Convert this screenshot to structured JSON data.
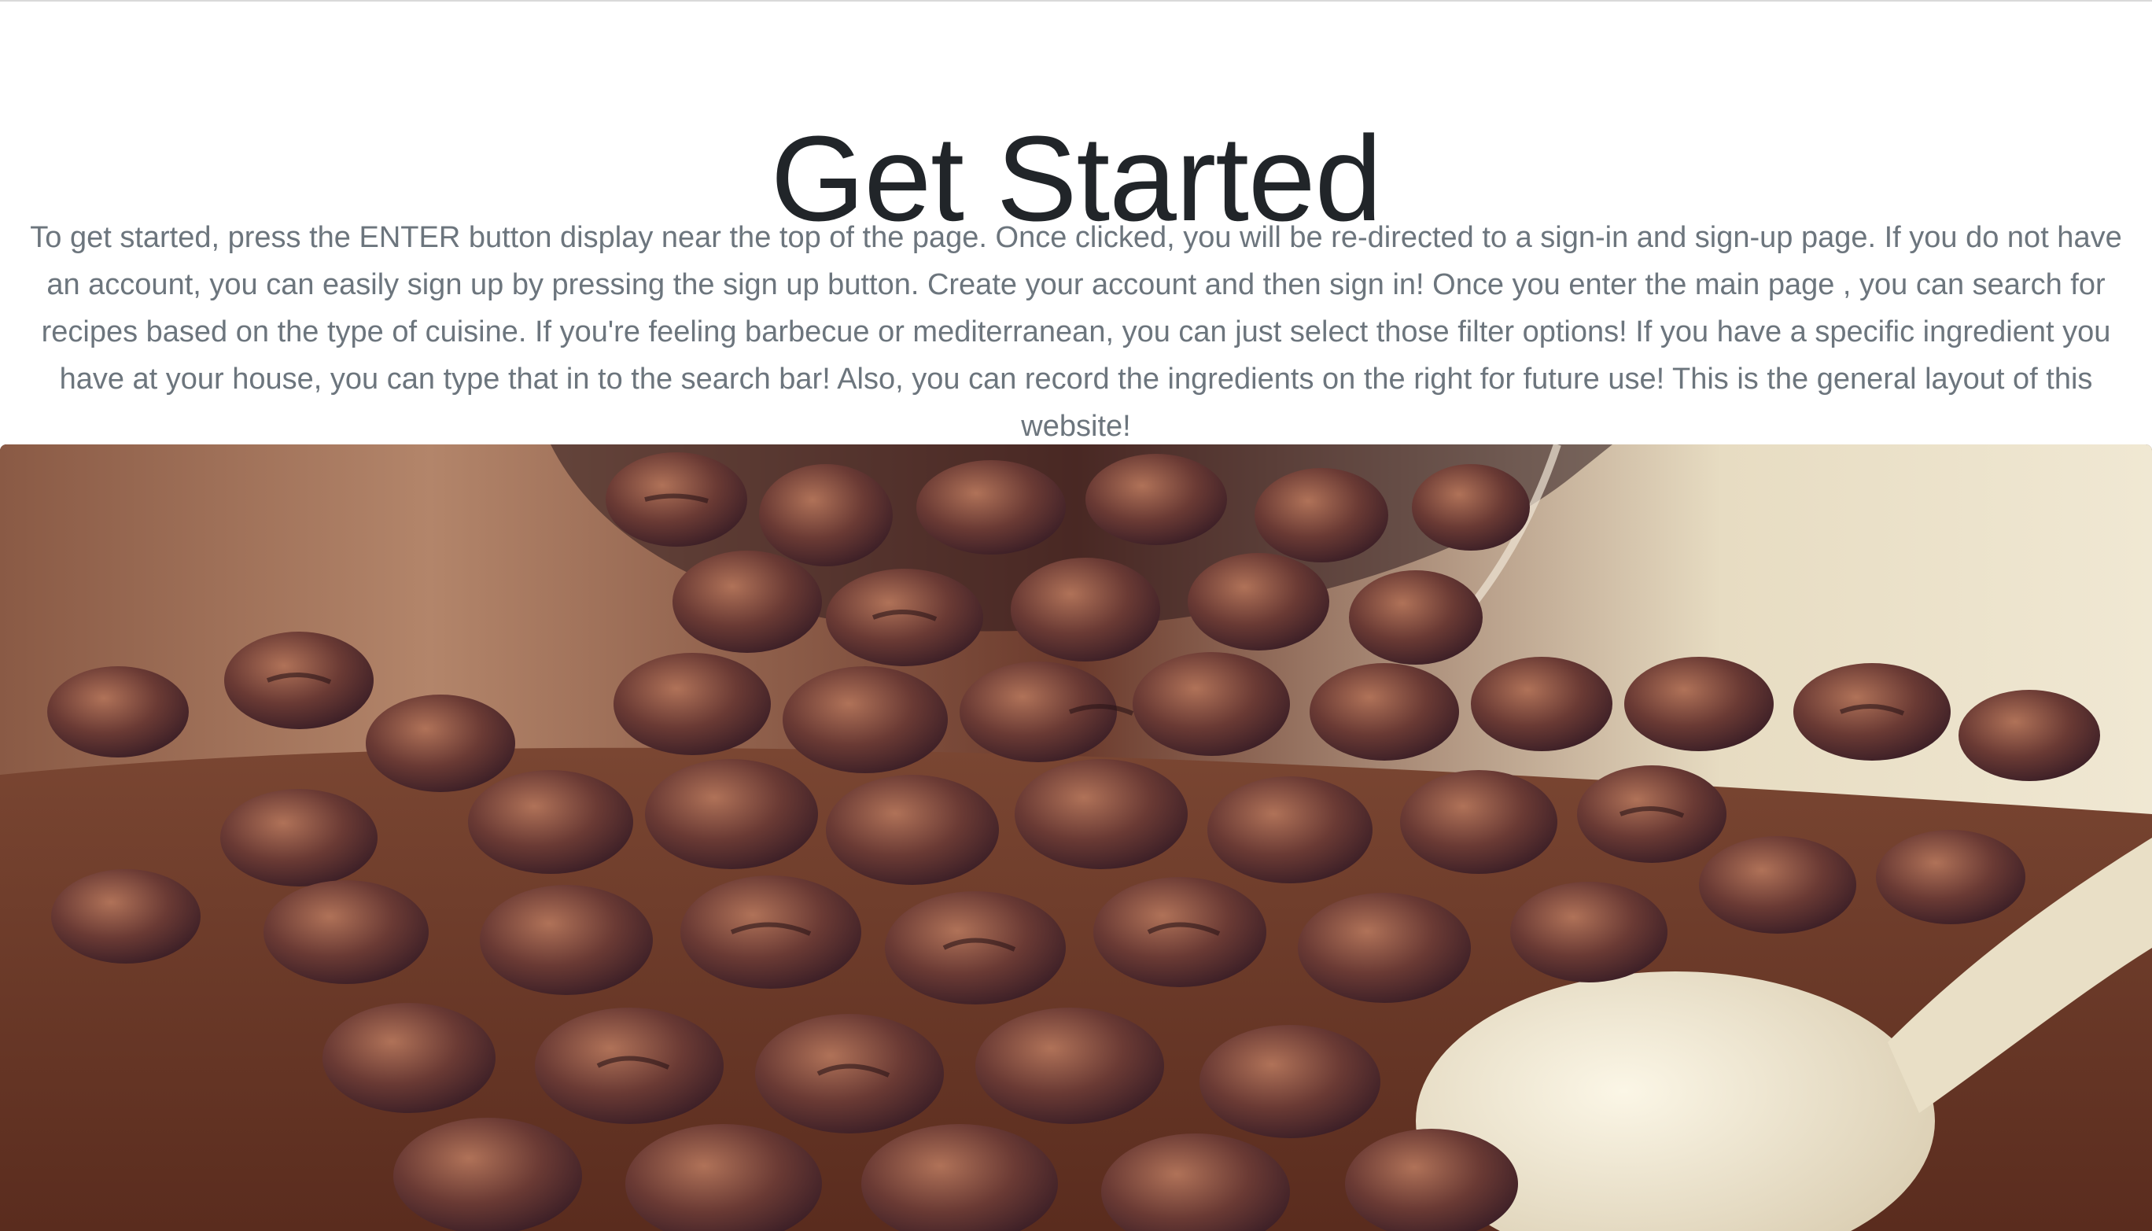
{
  "section": {
    "title": "Get Started",
    "description": "To get started, press the ENTER button display near the top of the page. Once clicked, you will be re-directed to a sign-in and sign-up page. If you do not have an account, you can easily sign up by pressing the sign up button. Create your account and then sign in! Once you enter the main page , you can search for recipes based on the type of cuisine. If you're feeling barbecue or mediterranean, you can just select those filter options! If you have a specific ingredient you have at your house, you can type that in to the search bar! Also, you can record the ingredients on the right for future use! This is the general layout of this website!"
  },
  "image": {
    "subject": "coffee beans spilling from a glass with a spoon",
    "colors": {
      "bean_dark": "#4a2630",
      "bean_mid": "#7a4436",
      "bean_light": "#a8684c",
      "table": "#6b3a26",
      "backdrop": "#efe6d0",
      "spoon": "#f1ead4"
    }
  }
}
